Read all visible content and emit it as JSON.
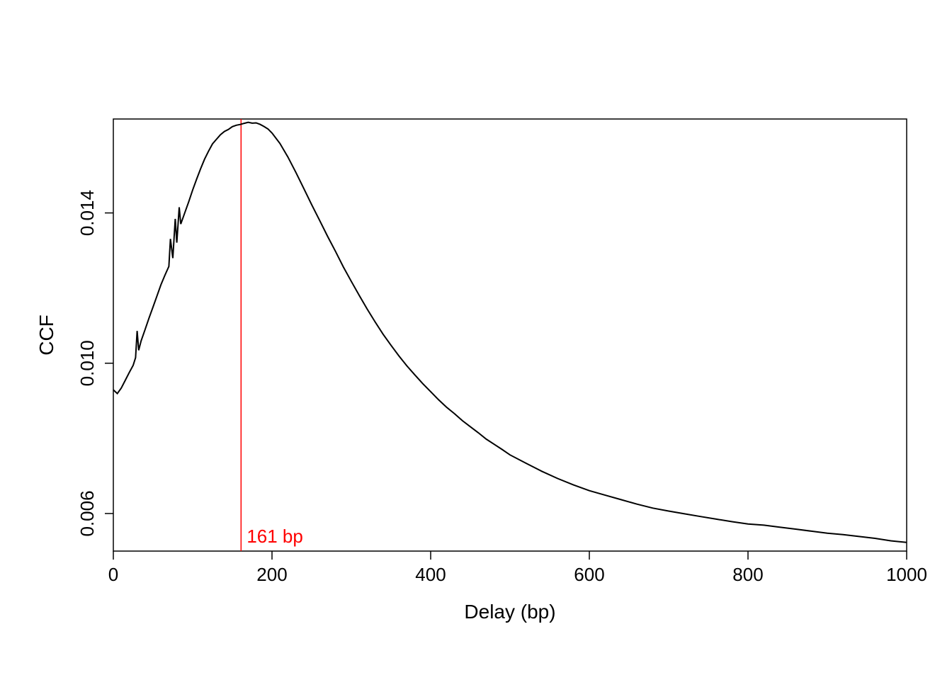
{
  "chart_data": {
    "type": "line",
    "title": "",
    "xlabel": "Delay (bp)",
    "ylabel": "CCF",
    "xlim": [
      0,
      1000
    ],
    "ylim": [
      0.005,
      0.0165
    ],
    "xticks": [
      0,
      200,
      400,
      600,
      800,
      1000
    ],
    "yticks": [
      0.006,
      0.01,
      0.014
    ],
    "ytick_labels": [
      "0.006",
      "0.010",
      "0.014"
    ],
    "annotation": {
      "x": 161,
      "label": "161 bp",
      "color": "#ff0000"
    },
    "series": [
      {
        "name": "CCF",
        "color": "#000000",
        "x": [
          0,
          5,
          10,
          15,
          20,
          25,
          28,
          30,
          32,
          35,
          40,
          45,
          50,
          55,
          60,
          65,
          70,
          72,
          75,
          78,
          80,
          83,
          85,
          90,
          95,
          100,
          105,
          110,
          115,
          120,
          125,
          130,
          135,
          140,
          145,
          150,
          155,
          160,
          165,
          170,
          175,
          180,
          185,
          190,
          195,
          200,
          210,
          220,
          230,
          240,
          250,
          260,
          270,
          280,
          290,
          300,
          310,
          320,
          330,
          340,
          350,
          360,
          370,
          380,
          390,
          400,
          410,
          420,
          430,
          440,
          450,
          460,
          470,
          480,
          490,
          500,
          520,
          540,
          560,
          580,
          600,
          620,
          640,
          660,
          680,
          700,
          720,
          740,
          760,
          780,
          800,
          820,
          840,
          860,
          880,
          900,
          920,
          940,
          960,
          980,
          1000
        ],
        "y": [
          0.0093,
          0.0092,
          0.00935,
          0.00955,
          0.00975,
          0.00995,
          0.01015,
          0.01085,
          0.01035,
          0.0106,
          0.0109,
          0.0112,
          0.0115,
          0.0118,
          0.0121,
          0.01235,
          0.01257,
          0.0133,
          0.0128,
          0.01385,
          0.0132,
          0.01415,
          0.0137,
          0.014,
          0.0143,
          0.0146,
          0.0149,
          0.01518,
          0.01543,
          0.01565,
          0.01583,
          0.01597,
          0.01608,
          0.01616,
          0.01623,
          0.01629,
          0.01633,
          0.01636,
          0.01638,
          0.0164,
          0.0164,
          0.01639,
          0.01636,
          0.01631,
          0.01623,
          0.01613,
          0.01584,
          0.01548,
          0.01508,
          0.01466,
          0.01423,
          0.0138,
          0.01338,
          0.01297,
          0.01257,
          0.01218,
          0.0118,
          0.01144,
          0.0111,
          0.01078,
          0.01048,
          0.0102,
          0.00994,
          0.00969,
          0.00946,
          0.00924,
          0.00903,
          0.00883,
          0.00865,
          0.00847,
          0.0083,
          0.00814,
          0.00798,
          0.00784,
          0.0077,
          0.00757,
          0.00733,
          0.00712,
          0.00693,
          0.00676,
          0.00661,
          0.00648,
          0.00636,
          0.00625,
          0.00615,
          0.00606,
          0.00599,
          0.00592,
          0.00585,
          0.00579,
          0.00573,
          0.00568,
          0.00563,
          0.00558,
          0.00553,
          0.00548,
          0.00543,
          0.00538,
          0.00533,
          0.00528,
          0.00523
        ]
      }
    ]
  },
  "colors": {
    "accent": "#ff0000",
    "foreground": "#000000",
    "background": "#ffffff"
  }
}
